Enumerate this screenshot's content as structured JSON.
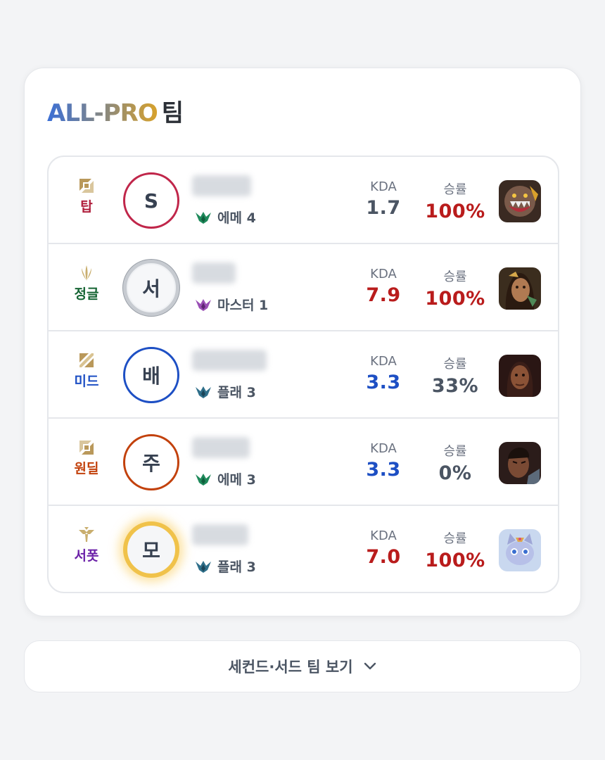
{
  "title": {
    "brand": "ALL-PRO",
    "suffix": "팀"
  },
  "players": [
    {
      "position": "탑",
      "position_icon": "top-lane-icon",
      "position_color": "#b01e3c",
      "initial": "S",
      "ring": "ring-red",
      "tier_icon": "emerald-icon",
      "tier": "에메 4",
      "kda_label": "KDA",
      "kda": "1.7",
      "kda_color": "#4b5563",
      "wr_label": "승률",
      "winrate": "100%",
      "wr_color": "#b91c1c",
      "champ_icon": "warwick-portrait"
    },
    {
      "position": "정글",
      "position_icon": "jungle-icon",
      "position_color": "#166534",
      "initial": "서",
      "ring": "ring-silver",
      "tier_icon": "master-icon",
      "tier": "마스터 1",
      "kda_label": "KDA",
      "kda": "7.9",
      "kda_color": "#b91c1c",
      "wr_label": "승률",
      "winrate": "100%",
      "wr_color": "#b91c1c",
      "champ_icon": "nidalee-portrait"
    },
    {
      "position": "미드",
      "position_icon": "mid-lane-icon",
      "position_color": "#1d4fc4",
      "initial": "배",
      "ring": "ring-blue",
      "tier_icon": "platinum-icon",
      "tier": "플래 3",
      "kda_label": "KDA",
      "kda": "3.3",
      "kda_color": "#1d4fc4",
      "wr_label": "승률",
      "winrate": "33%",
      "wr_color": "#4b5563",
      "champ_icon": "sylas-portrait"
    },
    {
      "position": "원딜",
      "position_icon": "bot-lane-icon",
      "position_color": "#c2410c",
      "initial": "주",
      "ring": "ring-orange",
      "tier_icon": "emerald-icon",
      "tier": "에메 3",
      "kda_label": "KDA",
      "kda": "3.3",
      "kda_color": "#1d4fc4",
      "wr_label": "승률",
      "winrate": "0%",
      "wr_color": "#4b5563",
      "champ_icon": "lucian-portrait"
    },
    {
      "position": "서폿",
      "position_icon": "support-icon",
      "position_color": "#6b21a8",
      "initial": "모",
      "ring": "ring-gold",
      "tier_icon": "platinum-icon",
      "tier": "플래 3",
      "kda_label": "KDA",
      "kda": "7.0",
      "kda_color": "#b91c1c",
      "wr_label": "승률",
      "winrate": "100%",
      "wr_color": "#b91c1c",
      "champ_icon": "yuumi-portrait"
    }
  ],
  "more_button": {
    "label": "세컨드·서드 팀 보기",
    "icon": "chevron-down-icon"
  }
}
